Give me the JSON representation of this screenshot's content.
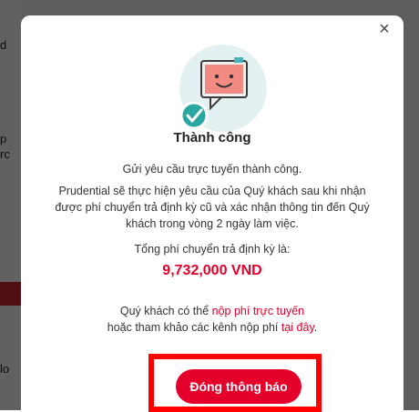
{
  "modal": {
    "close_symbol": "×",
    "title": "Thành công",
    "line1": "Gửi yêu cầu trực tuyến thành công.",
    "line2": "Prudential sẽ thực hiện yêu cầu của Quý khách sau khi nhận được phí chuyển trả định kỳ cũ và xác nhận thông tin đến Quý khách trong vòng 2 ngày làm việc.",
    "total_label": "Tổng phí chuyển trả định kỳ là:",
    "total_amount": "9,732,000 VND",
    "payment_prefix": "Quý khách có thể ",
    "payment_online_link": "nộp phí trực tuyến",
    "payment_middle": "hoặc tham khảo các kênh nộp phí ",
    "payment_here_link": "tại đây",
    "payment_suffix": ".",
    "close_button": "Đóng thông báo"
  },
  "background": {
    "fragments": [
      "d",
      "p",
      "rc",
      "lo"
    ]
  },
  "colors": {
    "accent": "#e4002b",
    "overlay": "rgba(0,0,0,0.62)",
    "illustration_bg": "#e3f1f3",
    "check": "#2aa7a0"
  },
  "icons": {
    "close": "close-icon",
    "illustration": "success-chat-illustration",
    "check": "check-icon"
  }
}
